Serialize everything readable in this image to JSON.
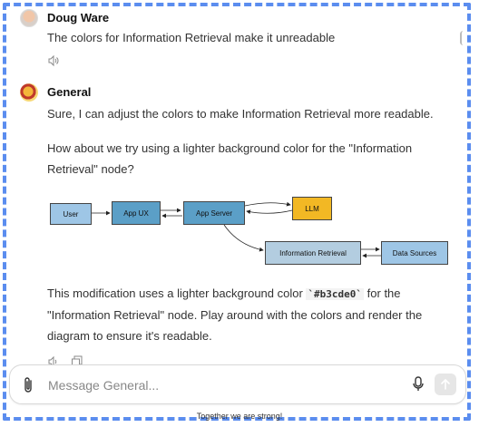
{
  "messages": [
    {
      "author": "Doug Ware",
      "text": "The colors for Information Retrieval make it unreadable"
    },
    {
      "author": "General",
      "para1": "Sure, I can adjust the colors to make Information Retrieval more readable.",
      "para2a": "How about we try using a lighter background color for the \"Information",
      "para2b": "Retrieval\" node?",
      "para3a_pre": "This modification uses a lighter background color ",
      "para3a_code": "`#b3cde0`",
      "para3a_post": " for the",
      "para3b": "\"Information Retrieval\" node. Play around with the colors and render the",
      "para3c": "diagram to ensure it's readable."
    }
  ],
  "diagram": {
    "nodes": {
      "user": "User",
      "app_ux": "App UX",
      "app_server": "App Server",
      "llm": "LLM",
      "info_retrieval": "Information Retrieval",
      "data_sources": "Data Sources"
    },
    "colors": {
      "user": "#9ec6e6",
      "app_ux": "#5b9fc7",
      "app_server": "#5b9fc7",
      "llm": "#f2b824",
      "info_retrieval": "#b3cde0",
      "data_sources": "#9ec6e6"
    }
  },
  "composer": {
    "placeholder": "Message General..."
  },
  "footer": "Together we are strong!"
}
